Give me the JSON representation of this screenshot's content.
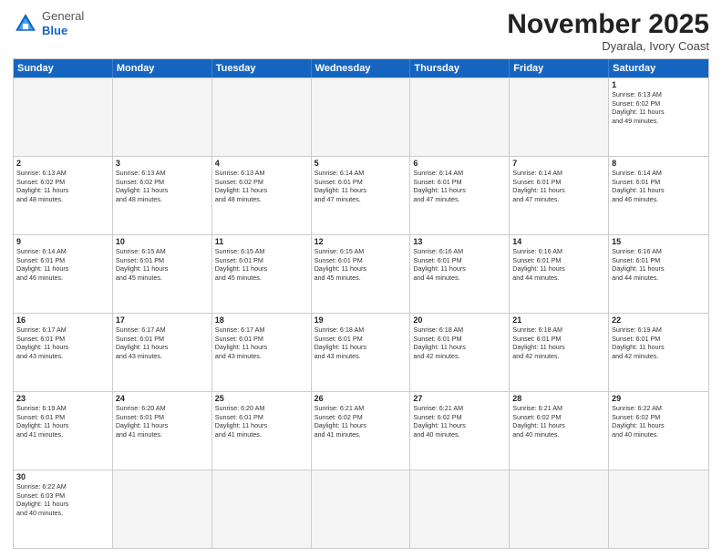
{
  "header": {
    "logo_general": "General",
    "logo_blue": "Blue",
    "month_title": "November 2025",
    "location": "Dyarala, Ivory Coast"
  },
  "day_headers": [
    "Sunday",
    "Monday",
    "Tuesday",
    "Wednesday",
    "Thursday",
    "Friday",
    "Saturday"
  ],
  "weeks": [
    {
      "cells": [
        {
          "day": "",
          "info": "",
          "empty": true
        },
        {
          "day": "",
          "info": "",
          "empty": true
        },
        {
          "day": "",
          "info": "",
          "empty": true
        },
        {
          "day": "",
          "info": "",
          "empty": true
        },
        {
          "day": "",
          "info": "",
          "empty": true
        },
        {
          "day": "",
          "info": "",
          "empty": true
        },
        {
          "day": "1",
          "info": "Sunrise: 6:13 AM\nSunset: 6:02 PM\nDaylight: 11 hours\nand 49 minutes."
        }
      ]
    },
    {
      "cells": [
        {
          "day": "2",
          "info": "Sunrise: 6:13 AM\nSunset: 6:02 PM\nDaylight: 11 hours\nand 48 minutes."
        },
        {
          "day": "3",
          "info": "Sunrise: 6:13 AM\nSunset: 6:02 PM\nDaylight: 11 hours\nand 48 minutes."
        },
        {
          "day": "4",
          "info": "Sunrise: 6:13 AM\nSunset: 6:02 PM\nDaylight: 11 hours\nand 48 minutes."
        },
        {
          "day": "5",
          "info": "Sunrise: 6:14 AM\nSunset: 6:01 PM\nDaylight: 11 hours\nand 47 minutes."
        },
        {
          "day": "6",
          "info": "Sunrise: 6:14 AM\nSunset: 6:01 PM\nDaylight: 11 hours\nand 47 minutes."
        },
        {
          "day": "7",
          "info": "Sunrise: 6:14 AM\nSunset: 6:01 PM\nDaylight: 11 hours\nand 47 minutes."
        },
        {
          "day": "8",
          "info": "Sunrise: 6:14 AM\nSunset: 6:01 PM\nDaylight: 11 hours\nand 46 minutes."
        }
      ]
    },
    {
      "cells": [
        {
          "day": "9",
          "info": "Sunrise: 6:14 AM\nSunset: 6:01 PM\nDaylight: 11 hours\nand 46 minutes."
        },
        {
          "day": "10",
          "info": "Sunrise: 6:15 AM\nSunset: 6:01 PM\nDaylight: 11 hours\nand 45 minutes."
        },
        {
          "day": "11",
          "info": "Sunrise: 6:15 AM\nSunset: 6:01 PM\nDaylight: 11 hours\nand 45 minutes."
        },
        {
          "day": "12",
          "info": "Sunrise: 6:15 AM\nSunset: 6:01 PM\nDaylight: 11 hours\nand 45 minutes."
        },
        {
          "day": "13",
          "info": "Sunrise: 6:16 AM\nSunset: 6:01 PM\nDaylight: 11 hours\nand 44 minutes."
        },
        {
          "day": "14",
          "info": "Sunrise: 6:16 AM\nSunset: 6:01 PM\nDaylight: 11 hours\nand 44 minutes."
        },
        {
          "day": "15",
          "info": "Sunrise: 6:16 AM\nSunset: 6:01 PM\nDaylight: 11 hours\nand 44 minutes."
        }
      ]
    },
    {
      "cells": [
        {
          "day": "16",
          "info": "Sunrise: 6:17 AM\nSunset: 6:01 PM\nDaylight: 11 hours\nand 43 minutes."
        },
        {
          "day": "17",
          "info": "Sunrise: 6:17 AM\nSunset: 6:01 PM\nDaylight: 11 hours\nand 43 minutes."
        },
        {
          "day": "18",
          "info": "Sunrise: 6:17 AM\nSunset: 6:01 PM\nDaylight: 11 hours\nand 43 minutes."
        },
        {
          "day": "19",
          "info": "Sunrise: 6:18 AM\nSunset: 6:01 PM\nDaylight: 11 hours\nand 43 minutes."
        },
        {
          "day": "20",
          "info": "Sunrise: 6:18 AM\nSunset: 6:01 PM\nDaylight: 11 hours\nand 42 minutes."
        },
        {
          "day": "21",
          "info": "Sunrise: 6:18 AM\nSunset: 6:01 PM\nDaylight: 11 hours\nand 42 minutes."
        },
        {
          "day": "22",
          "info": "Sunrise: 6:19 AM\nSunset: 6:01 PM\nDaylight: 11 hours\nand 42 minutes."
        }
      ]
    },
    {
      "cells": [
        {
          "day": "23",
          "info": "Sunrise: 6:19 AM\nSunset: 6:01 PM\nDaylight: 11 hours\nand 41 minutes."
        },
        {
          "day": "24",
          "info": "Sunrise: 6:20 AM\nSunset: 6:01 PM\nDaylight: 11 hours\nand 41 minutes."
        },
        {
          "day": "25",
          "info": "Sunrise: 6:20 AM\nSunset: 6:01 PM\nDaylight: 11 hours\nand 41 minutes."
        },
        {
          "day": "26",
          "info": "Sunrise: 6:21 AM\nSunset: 6:02 PM\nDaylight: 11 hours\nand 41 minutes."
        },
        {
          "day": "27",
          "info": "Sunrise: 6:21 AM\nSunset: 6:02 PM\nDaylight: 11 hours\nand 40 minutes."
        },
        {
          "day": "28",
          "info": "Sunrise: 6:21 AM\nSunset: 6:02 PM\nDaylight: 11 hours\nand 40 minutes."
        },
        {
          "day": "29",
          "info": "Sunrise: 6:22 AM\nSunset: 6:02 PM\nDaylight: 11 hours\nand 40 minutes."
        }
      ]
    },
    {
      "cells": [
        {
          "day": "30",
          "info": "Sunrise: 6:22 AM\nSunset: 6:03 PM\nDaylight: 11 hours\nand 40 minutes."
        },
        {
          "day": "",
          "info": "",
          "empty": true
        },
        {
          "day": "",
          "info": "",
          "empty": true
        },
        {
          "day": "",
          "info": "",
          "empty": true
        },
        {
          "day": "",
          "info": "",
          "empty": true
        },
        {
          "day": "",
          "info": "",
          "empty": true
        },
        {
          "day": "",
          "info": "",
          "empty": true
        }
      ]
    }
  ]
}
